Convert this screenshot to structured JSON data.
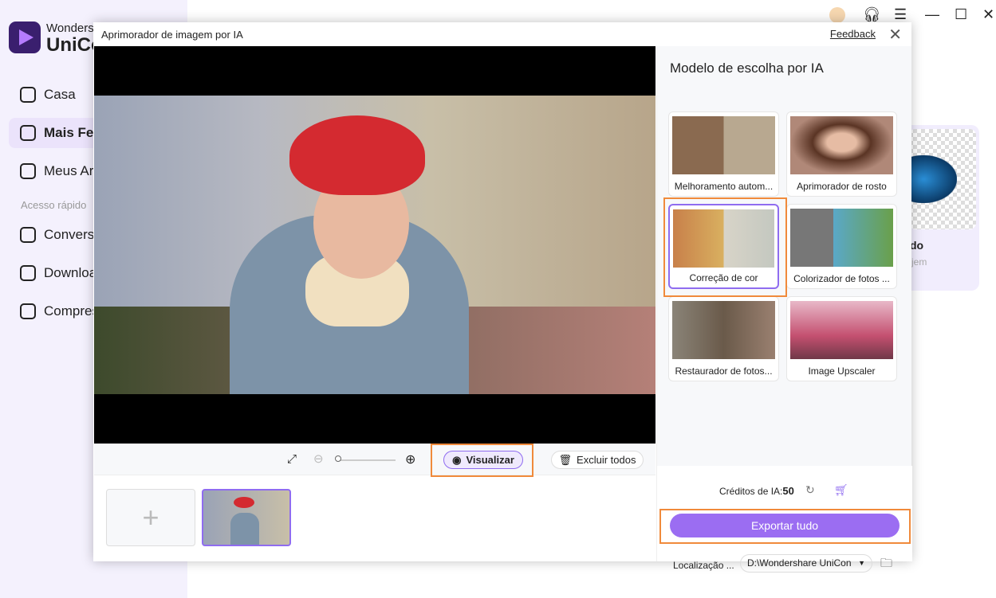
{
  "app": {
    "brand_line1": "Wonders",
    "brand_line2": "UniCo"
  },
  "sidebar": {
    "items": [
      {
        "label": "Casa"
      },
      {
        "label": "Mais Fe"
      },
      {
        "label": "Meus Arc"
      }
    ],
    "quick_access": "Acesso rápido",
    "quick": [
      {
        "label": "Converso"
      },
      {
        "label": "Downloa"
      },
      {
        "label": "Compres"
      }
    ]
  },
  "background_card": {
    "title": "do",
    "subtitle": "jem"
  },
  "dialog": {
    "title": "Aprimorador de imagem por IA",
    "feedback": "Feedback",
    "close": "✕"
  },
  "toolbar": {
    "preview": "Visualizar",
    "delete_all": "Excluir todos",
    "zoom_level": 0
  },
  "thumbs": {
    "add": "+"
  },
  "panel": {
    "heading": "Modelo de escolha por IA",
    "models": [
      {
        "label": "Melhoramento autom...",
        "selected": false
      },
      {
        "label": "Aprimorador de rosto",
        "selected": false
      },
      {
        "label": "Correção de cor",
        "selected": true
      },
      {
        "label": "Colorizador de fotos ...",
        "selected": false
      },
      {
        "label": "Restaurador de fotos...",
        "selected": false
      },
      {
        "label": "Image Upscaler",
        "selected": false
      }
    ],
    "credits_label": "Créditos de IA:",
    "credits_value": "50",
    "export": "Exportar tudo",
    "location_label": "Localização ...",
    "location_value": "D:\\Wondershare UniCon"
  },
  "colors": {
    "accent": "#9b6df2",
    "highlight": "#f08a3b"
  }
}
